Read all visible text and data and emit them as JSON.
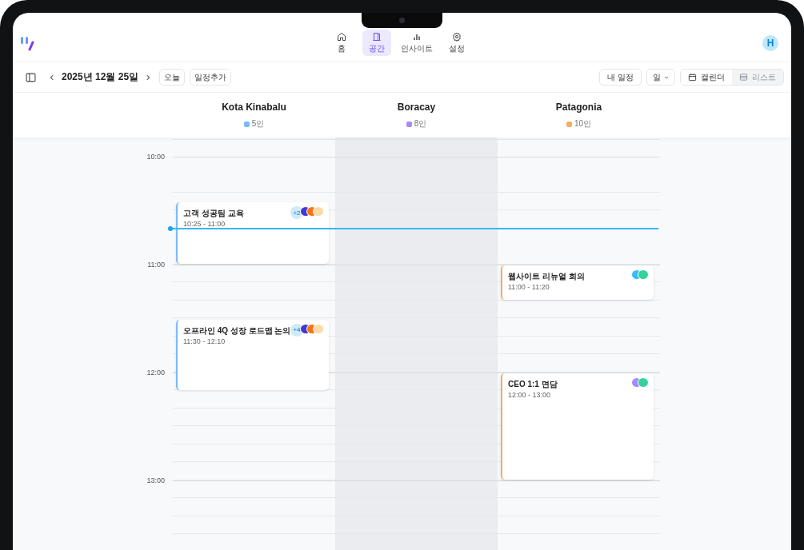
{
  "nav": {
    "items": [
      {
        "label": "홈",
        "selected": false
      },
      {
        "label": "공간",
        "selected": true
      },
      {
        "label": "인사이트",
        "selected": false
      },
      {
        "label": "설정",
        "selected": false
      }
    ],
    "user_initial": "H"
  },
  "toolbar": {
    "date": "2025년 12월 25일",
    "today": "오늘",
    "add_event": "일정추가",
    "my_schedule": "내 일정",
    "range": "일",
    "views": [
      {
        "label": "캘린더",
        "selected": true
      },
      {
        "label": "리스트",
        "selected": false
      }
    ]
  },
  "hours": [
    "10:00",
    "11:00",
    "12:00",
    "13:00"
  ],
  "spaces": [
    {
      "name": "Kota Kinabalu",
      "count": "5인",
      "color": "#7cb8f7",
      "shaded": false,
      "events": [
        {
          "title": "고객 성공팀 교육",
          "time": "10:25 - 11:00",
          "extra": "+2",
          "avatars": [
            {
              "color": "#4338ca"
            },
            {
              "color": "#f97316"
            },
            {
              "color": "#fcd9a8"
            }
          ]
        },
        {
          "title": "오프라인 4Q 성장 로드맵 논의",
          "time": "11:30 - 12:10",
          "extra": "+4",
          "avatars": [
            {
              "color": "#4338ca"
            },
            {
              "color": "#f97316"
            },
            {
              "color": "#fcd9a8"
            }
          ]
        }
      ]
    },
    {
      "name": "Boracay",
      "count": "8인",
      "color": "#a98bf0",
      "shaded": true
    },
    {
      "name": "Patagonia",
      "count": "10인",
      "color": "#f8ad62",
      "shaded": false,
      "events": [
        {
          "title": "웹사이트 리뉴얼 회의",
          "time": "11:00 - 11:20",
          "avatars": [
            {
              "color": "#38bdf8"
            },
            {
              "color": "#34d399"
            }
          ]
        },
        {
          "title": "CEO 1:1 면담",
          "time": "12:00 - 13:00",
          "avatars": [
            {
              "color": "#a78bfa"
            },
            {
              "color": "#34d399"
            }
          ]
        }
      ]
    }
  ]
}
